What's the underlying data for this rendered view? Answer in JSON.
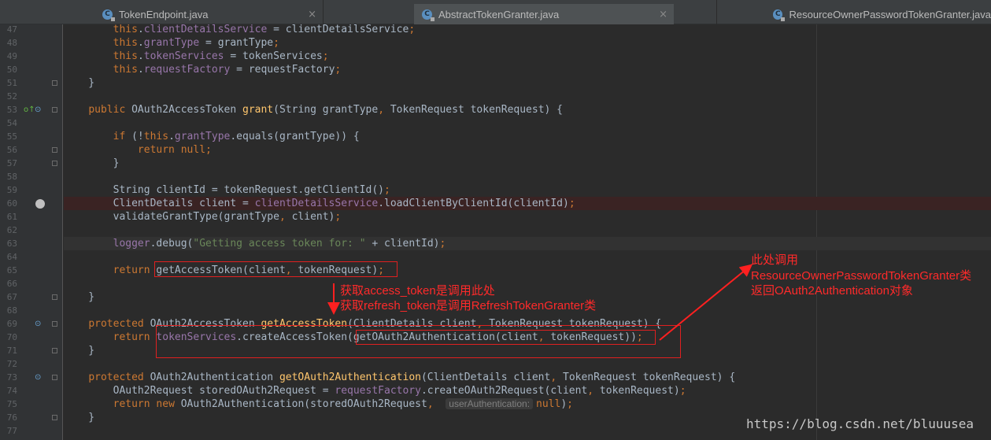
{
  "tabs": [
    {
      "label": "TokenEndpoint.java",
      "active": false,
      "icon": "java-class-icon"
    },
    {
      "label": "AbstractTokenGranter.java",
      "active": true,
      "icon": "java-class-icon"
    },
    {
      "label": "ResourceOwnerPasswordTokenGranter.java",
      "active": false,
      "icon": "java-class-icon"
    }
  ],
  "close_glyph": "×",
  "lines": [
    {
      "n": "47",
      "html": "        <span class=\"kw\">this</span>.<span class=\"fld\">clientDetailsService</span> = clientDetailsService<span class=\"kw\">;</span>"
    },
    {
      "n": "48",
      "html": "        <span class=\"kw\">this</span>.<span class=\"fld\">grantType</span> = grantType<span class=\"kw\">;</span>"
    },
    {
      "n": "49",
      "html": "        <span class=\"kw\">this</span>.<span class=\"fld\">tokenServices</span> = tokenServices<span class=\"kw\">;</span>"
    },
    {
      "n": "50",
      "html": "        <span class=\"kw\">this</span>.<span class=\"fld\">requestFactory</span> = requestFactory<span class=\"kw\">;</span>"
    },
    {
      "n": "51",
      "html": "    }"
    },
    {
      "n": "52",
      "html": ""
    },
    {
      "n": "53",
      "html": "    <span class=\"kw\">public</span> OAuth2AccessToken <span class=\"fn\">grant</span>(String grantType<span class=\"kw\">,</span> TokenRequest tokenRequest) {"
    },
    {
      "n": "54",
      "html": ""
    },
    {
      "n": "55",
      "html": "        <span class=\"kw\">if</span> (!<span class=\"kw\">this</span>.<span class=\"fld\">grantType</span>.equals(grantType)) {"
    },
    {
      "n": "56",
      "html": "            <span class=\"kw\">return null;</span>"
    },
    {
      "n": "57",
      "html": "        }"
    },
    {
      "n": "58",
      "html": ""
    },
    {
      "n": "59",
      "html": "        String clientId = tokenRequest.getClientId()<span class=\"kw\">;</span>"
    },
    {
      "n": "60",
      "html": "        ClientDetails client = <span class=\"fld\">clientDetailsService</span>.loadClientByClientId(clientId)<span class=\"kw\">;</span>",
      "cls": "err"
    },
    {
      "n": "61",
      "html": "        validateGrantType(grantType<span class=\"kw\">,</span> client)<span class=\"kw\">;</span>"
    },
    {
      "n": "62",
      "html": ""
    },
    {
      "n": "63",
      "html": "        <span class=\"fld\">logger</span>.debug(<span class=\"str\">\"Getting access token for: \"</span> + clientId)<span class=\"kw\">;</span>",
      "cls": "cur"
    },
    {
      "n": "64",
      "html": ""
    },
    {
      "n": "65",
      "html": "        <span class=\"kw\">return</span> getAccessToken(client<span class=\"kw\">,</span> tokenRequest)<span class=\"kw\">;</span>"
    },
    {
      "n": "66",
      "html": ""
    },
    {
      "n": "67",
      "html": "    }"
    },
    {
      "n": "68",
      "html": ""
    },
    {
      "n": "69",
      "html": "    <span class=\"kw\">protected</span> OAuth2AccessToken <span class=\"fn\">getAccessToken</span>(ClientDetails client<span class=\"kw\">,</span> TokenRequest tokenRequest) {"
    },
    {
      "n": "70",
      "html": "        <span class=\"kw\">return</span> <span class=\"fld\">tokenServices</span>.createAccessToken(getOAuth2Authentication(client<span class=\"kw\">,</span> tokenRequest))<span class=\"kw\">;</span>"
    },
    {
      "n": "71",
      "html": "    }"
    },
    {
      "n": "72",
      "html": ""
    },
    {
      "n": "73",
      "html": "    <span class=\"kw\">protected</span> OAuth2Authentication <span class=\"fn\">getOAuth2Authentication</span>(ClientDetails client<span class=\"kw\">,</span> TokenRequest tokenRequest) {"
    },
    {
      "n": "74",
      "html": "        OAuth2Request storedOAuth2Request = <span class=\"fld\">requestFactory</span>.createOAuth2Request(client<span class=\"kw\">,</span> tokenRequest)<span class=\"kw\">;</span>"
    },
    {
      "n": "75",
      "html": "        <span class=\"kw\">return new</span> OAuth2Authentication(storedOAuth2Request<span class=\"kw\">,</span>  <span class=\"hint\">userAuthentication:</span><span class=\"kw\">null</span>)<span class=\"kw\">;</span>"
    },
    {
      "n": "76",
      "html": "    }"
    },
    {
      "n": "77",
      "html": ""
    }
  ],
  "annotations": {
    "access_token": "获取access_token是调用此处",
    "refresh_token": "获取refresh_token是调用RefreshTokenGranter类",
    "right_line1": "此处调用",
    "right_line2": "ResourceOwnerPasswordTokenGranter类",
    "right_line3": "返回OAuth2Authentication对象"
  },
  "watermark": "https://blog.csdn.net/bluuusea"
}
